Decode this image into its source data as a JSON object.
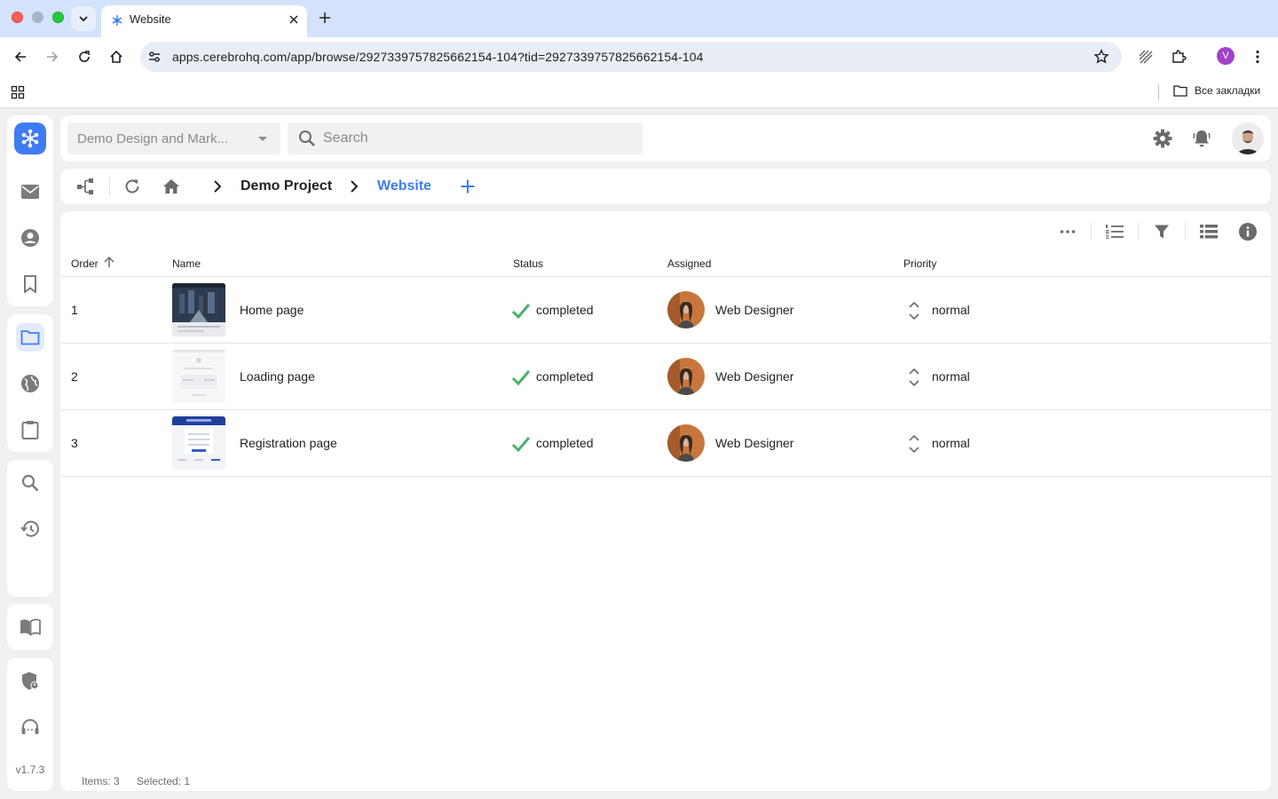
{
  "browser": {
    "tab_title": "Website",
    "url": "apps.cerebrohq.com/app/browse/2927339757825662154-104?tid=2927339757825662154-104",
    "profile_initial": "V",
    "bookmarks_all": "Все закладки"
  },
  "app": {
    "version": "v1.7.3",
    "project_selector": "Demo Design and Mark...",
    "search_placeholder": "Search"
  },
  "breadcrumb": {
    "items": [
      "Demo Project",
      "Website"
    ]
  },
  "table": {
    "columns": [
      "Order",
      "Name",
      "Status",
      "Assigned",
      "Priority"
    ],
    "rows": [
      {
        "order": "1",
        "name": "Home page",
        "status": "completed",
        "assigned": "Web Designer",
        "priority": "normal"
      },
      {
        "order": "2",
        "name": "Loading page",
        "status": "completed",
        "assigned": "Web Designer",
        "priority": "normal"
      },
      {
        "order": "3",
        "name": "Registration page",
        "status": "completed",
        "assigned": "Web Designer",
        "priority": "normal"
      }
    ]
  },
  "footer": {
    "items": "Items: 3",
    "selected": "Selected: 1"
  },
  "colors": {
    "accent": "#3d7cf5",
    "status_completed": "#4caf6a",
    "tab_strip": "#d3e3fd"
  }
}
